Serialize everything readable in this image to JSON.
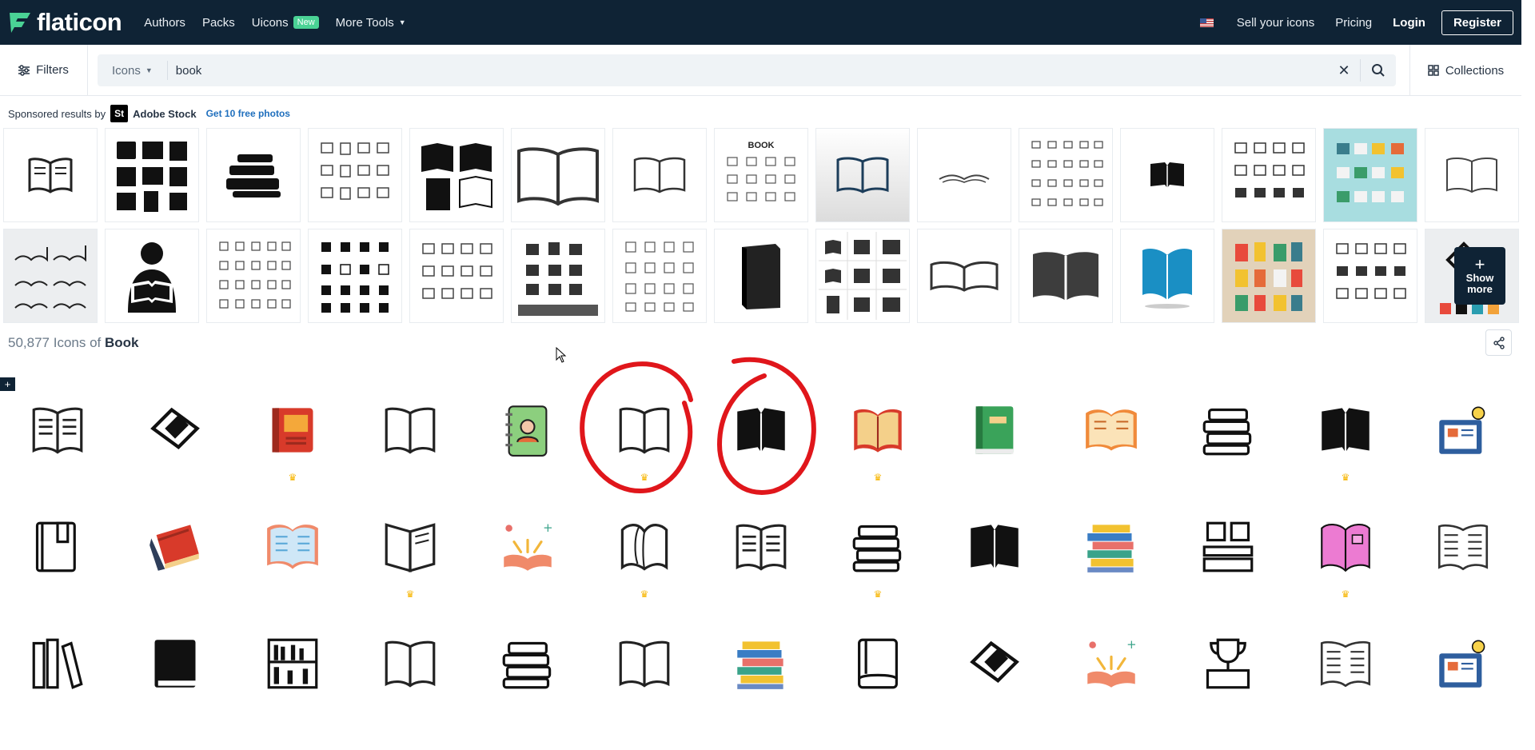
{
  "nav": {
    "brand": "flaticon",
    "links": [
      "Authors",
      "Packs",
      "Uicons",
      "More Tools"
    ],
    "new_badge": "New",
    "sell": "Sell your icons",
    "pricing": "Pricing",
    "login": "Login",
    "register": "Register"
  },
  "search": {
    "filters_label": "Filters",
    "type": "Icons",
    "query": "book",
    "collections_label": "Collections"
  },
  "sponsored": {
    "prefix": "Sponsored results by",
    "brand_badge": "St",
    "brand": "Adobe Stock",
    "free_link": "Get 10 free photos",
    "show_more_line1": "Show",
    "show_more_line2": "more",
    "tile_label": "BOOK"
  },
  "results": {
    "count": "50,877",
    "middle": "Icons of",
    "term": "Book"
  },
  "colors": {
    "nav_bg": "#0f2335",
    "accent_green": "#4ad295",
    "link_blue": "#1f6fbd",
    "crown": "#f7b500",
    "annotation_red": "#e0161b"
  },
  "icons_rows": [
    [
      "open-book-lines",
      "diamond-book",
      "red-book",
      "open-book-outline",
      "address-book",
      "open-book-outline",
      "open-book-black",
      "red-book-open",
      "green-book",
      "orange-open-book",
      "book-stack",
      "open-book-black",
      "book-lightbulb"
    ],
    [
      "book-bookmark",
      "red-book-tilted",
      "blue-open-book",
      "open-book-3d",
      "open-book-sparks",
      "open-book-pages",
      "open-book-lines",
      "book-stack",
      "open-book-black",
      "colorful-book-stack",
      "book-grid",
      "pink-book",
      "open-book-text"
    ],
    [
      "books-shelf",
      "black-book",
      "bookshelf",
      "open-book-outline",
      "book-stack",
      "open-book-outline",
      "colorful-book-stack",
      "book-closed",
      "diamond-book",
      "open-book-sparks",
      "trophy-book",
      "open-book-text",
      "book-lightbulb"
    ]
  ],
  "premium_cells": [
    [
      2,
      5,
      7,
      11
    ],
    [
      3,
      5,
      7,
      11
    ],
    []
  ]
}
